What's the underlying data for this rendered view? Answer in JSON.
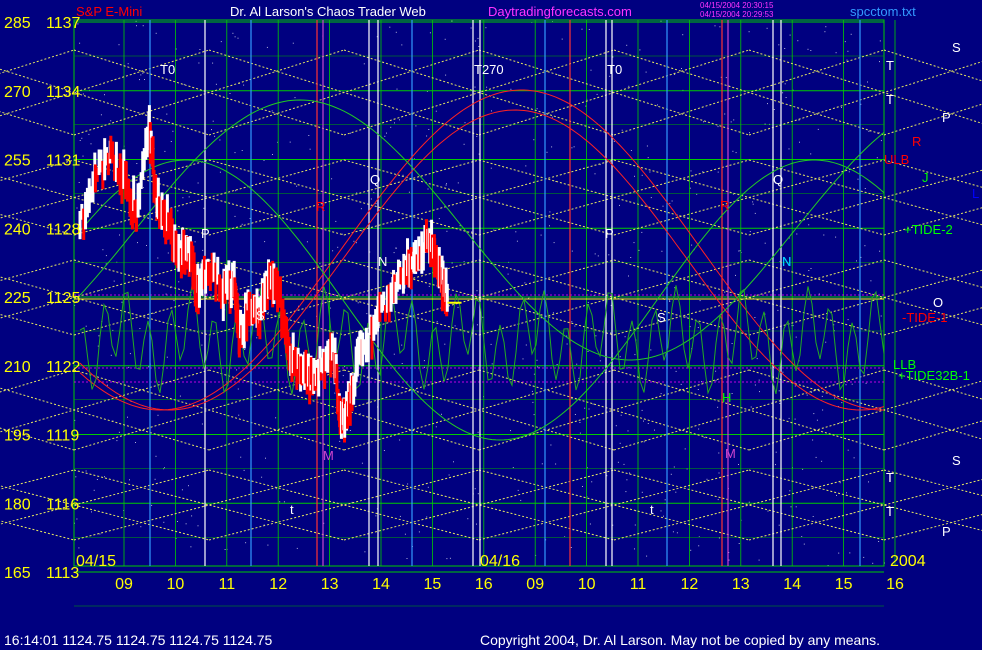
{
  "header": {
    "title_left": "S&P E-Mini",
    "title_center": "Dr. Al Larson's Chaos Trader Web",
    "site": "Daytradingforecasts.com",
    "timestamp1": "04/15/2004 20:30:15",
    "timestamp2": "04/15/2004 20:29:53",
    "file": "spcctom.txt"
  },
  "footer": {
    "quote": "16:14:01  1124.75 1124.75 1124.75 1124.75",
    "copyright": "Copyright 2004, Dr. Al Larson. May not be copied by any means."
  },
  "colors": {
    "background": "#000080",
    "price_up": "#ffffff",
    "price_down": "#ff0000",
    "grid_h": "#00cc00",
    "diamonds": "#e8e860"
  },
  "chart_data": {
    "type": "candlestick",
    "y_left": [
      "285",
      "270",
      "255",
      "240",
      "225",
      "210",
      "195",
      "180",
      "165"
    ],
    "y_right": [
      "1137",
      "1134",
      "1131",
      "1128",
      "1125",
      "1122",
      "1119",
      "1116",
      "1113"
    ],
    "ylim": [
      1113,
      1137
    ],
    "x_ticks": [
      "09",
      "10",
      "11",
      "12",
      "13",
      "14",
      "15",
      "16",
      "09",
      "10",
      "11",
      "12",
      "13",
      "14",
      "15",
      "16"
    ],
    "date_labels": [
      "04/15",
      "04/16",
      "2004"
    ],
    "last_price": 1124.75,
    "close_path": [
      [
        0.0,
        1128.0
      ],
      [
        0.3,
        1130.5
      ],
      [
        0.6,
        1131.2
      ],
      [
        0.9,
        1130.0
      ],
      [
        1.1,
        1128.6
      ],
      [
        1.35,
        1132.2
      ],
      [
        1.5,
        1129.2
      ],
      [
        1.7,
        1128.2
      ],
      [
        1.9,
        1126.8
      ],
      [
        2.1,
        1127.0
      ],
      [
        2.3,
        1125.2
      ],
      [
        2.5,
        1126.2
      ],
      [
        2.8,
        1125.0
      ],
      [
        3.0,
        1125.8
      ],
      [
        3.1,
        1123.2
      ],
      [
        3.3,
        1124.6
      ],
      [
        3.5,
        1124.2
      ],
      [
        3.7,
        1126.0
      ],
      [
        3.9,
        1124.8
      ],
      [
        4.1,
        1122.5
      ],
      [
        4.3,
        1121.8
      ],
      [
        4.5,
        1121.3
      ],
      [
        4.7,
        1122.0
      ],
      [
        4.95,
        1122.5
      ],
      [
        5.05,
        1120.0
      ],
      [
        5.15,
        1119.6
      ],
      [
        5.3,
        1121.0
      ],
      [
        5.5,
        1122.8
      ],
      [
        5.8,
        1124.2
      ],
      [
        6.1,
        1125.2
      ],
      [
        6.3,
        1126.0
      ],
      [
        6.5,
        1126.6
      ],
      [
        6.75,
        1127.5
      ],
      [
        6.9,
        1127.0
      ],
      [
        7.05,
        1125.6
      ],
      [
        7.15,
        1124.75
      ]
    ],
    "labels": [
      {
        "text": "T0",
        "color": "#ffffff"
      },
      {
        "text": "T270",
        "color": "#ffffff"
      },
      {
        "text": "T0",
        "color": "#ffffff"
      },
      {
        "text": "P",
        "color": "#ffffff"
      },
      {
        "text": "S",
        "color": "#ffffff"
      },
      {
        "text": "Q",
        "color": "#ffffff"
      },
      {
        "text": "N",
        "color": "#ffffff"
      },
      {
        "text": "R",
        "color": "#ff0000"
      },
      {
        "text": "M",
        "color": "#cc44cc"
      },
      {
        "text": "t",
        "color": "#ffffff"
      },
      {
        "text": "P",
        "color": "#ffffff"
      },
      {
        "text": "S",
        "color": "#ffffff"
      },
      {
        "text": "Q",
        "color": "#ffffff"
      },
      {
        "text": "N",
        "color": "#00ccff"
      },
      {
        "text": "R",
        "color": "#ff0000"
      },
      {
        "text": "H",
        "color": "#00ff00"
      },
      {
        "text": "M",
        "color": "#cc44cc"
      },
      {
        "text": "t",
        "color": "#ffffff"
      }
    ],
    "side_labels": [
      {
        "text": "S",
        "color": "#ffffff"
      },
      {
        "text": "T",
        "color": "#ffffff"
      },
      {
        "text": "T",
        "color": "#ffffff"
      },
      {
        "text": "P",
        "color": "#ffffff"
      },
      {
        "text": "R",
        "color": "#ff0000"
      },
      {
        "text": "ULB",
        "color": "#ff0000"
      },
      {
        "text": "J",
        "color": "#00ff00"
      },
      {
        "text": "L",
        "color": "#0000ff"
      },
      {
        "text": "+TIDE-2",
        "color": "#00ff00"
      },
      {
        "text": "N",
        "color": "#00ccff"
      },
      {
        "text": "O",
        "color": "#ffffff"
      },
      {
        "text": "-TIDE-1",
        "color": "#ff0000"
      },
      {
        "text": "LLB",
        "color": "#00ff00"
      },
      {
        "text": "+TIDE32B-1",
        "color": "#00ff00"
      },
      {
        "text": "S",
        "color": "#ffffff"
      },
      {
        "text": "T",
        "color": "#ffffff"
      },
      {
        "text": "T",
        "color": "#ffffff"
      },
      {
        "text": "P",
        "color": "#ffffff"
      }
    ]
  }
}
